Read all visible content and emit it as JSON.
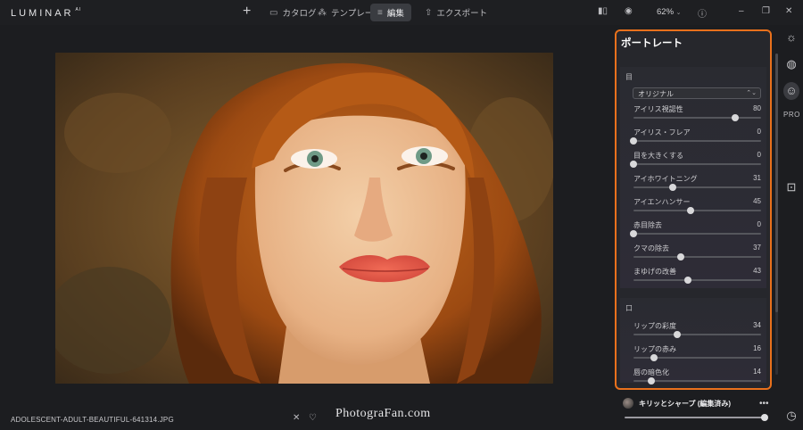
{
  "app": {
    "logo": "LUMINAR",
    "logo_suffix": "AI"
  },
  "topbar": {
    "add_icon": "plus",
    "tabs": [
      {
        "label": "カタログ",
        "icon": "folder-icon",
        "glyph": "▭"
      },
      {
        "label": "テンプレート",
        "icon": "template-icon",
        "glyph": "⁂"
      },
      {
        "label": "編集",
        "icon": "edit-icon",
        "glyph": "≡",
        "active": true
      },
      {
        "label": "エクスポート",
        "icon": "export-icon",
        "glyph": "⇧"
      }
    ],
    "zoom": "62%"
  },
  "photo": {
    "filename": "ADOLESCENT-ADULT-BEAUTIFUL-641314.JPG"
  },
  "watermark": "PhotograFan.com",
  "panel": {
    "title": "ポートレート",
    "eye_section": {
      "heading": "目",
      "dropdown": "オリジナル",
      "sliders": [
        {
          "label": "アイリス視認性",
          "value": 80,
          "pos": 0.8
        },
        {
          "label": "アイリス・フレア",
          "value": 0,
          "pos": 0.0
        },
        {
          "label": "目を大きくする",
          "value": 0,
          "pos": 0.0
        },
        {
          "label": "アイホワイトニング",
          "value": 31,
          "pos": 0.31
        },
        {
          "label": "アイエンハンサー",
          "value": 45,
          "pos": 0.45
        },
        {
          "label": "赤目除去",
          "value": 0,
          "pos": 0.0
        },
        {
          "label": "クマの除去",
          "value": 37,
          "pos": 0.37
        },
        {
          "label": "まゆげの改善",
          "value": 43,
          "pos": 0.43
        }
      ]
    },
    "mouth_section": {
      "heading": "口",
      "sliders": [
        {
          "label": "リップの彩度",
          "value": 34,
          "pos": 0.34
        },
        {
          "label": "リップの赤み",
          "value": 16,
          "pos": 0.16
        },
        {
          "label": "唇の暗色化",
          "value": 14,
          "pos": 0.14
        }
      ]
    }
  },
  "preset": {
    "name": "キリッとシャープ (編集済み)",
    "more": "•••",
    "amount": 1.0
  },
  "colors": {
    "accent": "#e9711c",
    "background": "#1c1d20",
    "panel": "#26272c"
  }
}
